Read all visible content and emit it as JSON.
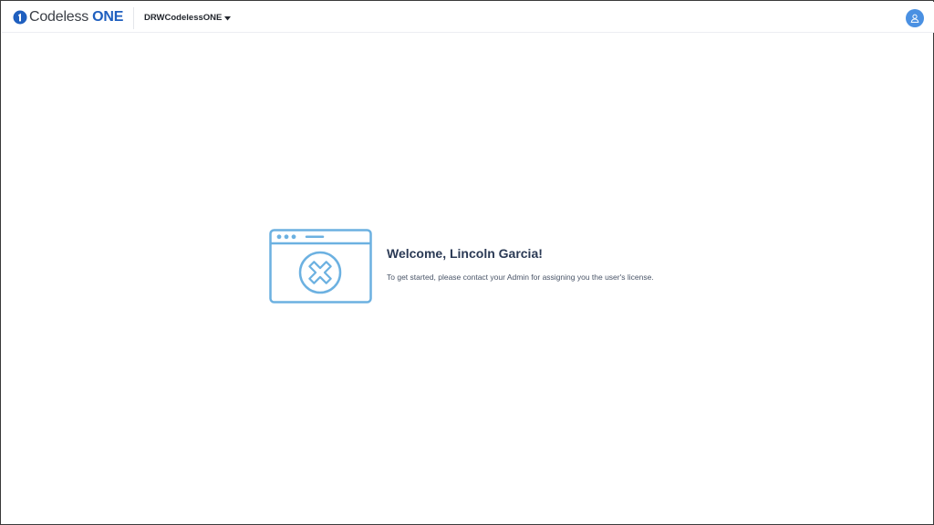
{
  "header": {
    "logo": {
      "text_primary": "Codeless",
      "text_secondary": "ONE"
    },
    "workspace": {
      "name": "DRWCodelessONE",
      "icon": "caret-down-icon"
    },
    "user_menu": {
      "icon": "user-icon"
    }
  },
  "main": {
    "illustration": {
      "icon": "browser-window-error-icon"
    },
    "title": "Welcome, Lincoln Garcia!",
    "message": "To get started, please contact your Admin for assigning you the user's license."
  },
  "colors": {
    "brand_blue": "#1f5fbf",
    "avatar_blue": "#4a90e2",
    "illustration_blue": "#6cb1e1",
    "title_text": "#2b3a55",
    "body_text": "#4a5568"
  }
}
